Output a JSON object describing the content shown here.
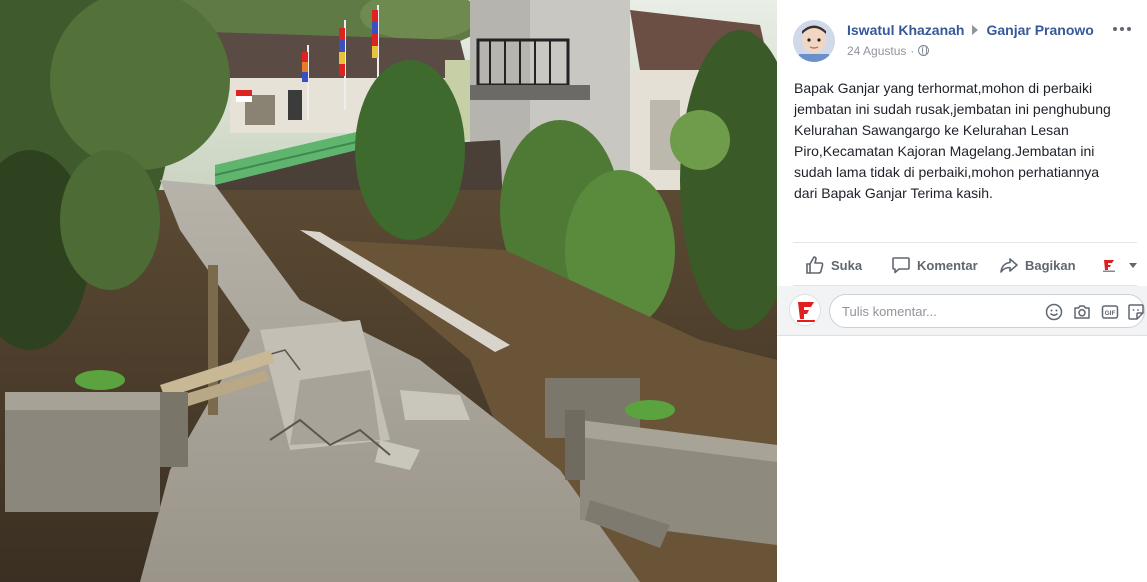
{
  "post": {
    "author": "Iswatul Khazanah",
    "target_page": "Ganjar Pranowo",
    "date": "24 Agustus",
    "separator": "·",
    "text_lines": [
      "Bapak Ganjar yang terhormat,mohon di perbaiki",
      "jembatan ini sudah rusak,jembatan ini penghubung",
      "Kelurahan Sawangargo ke Kelurahan Lesan",
      "Piro,Kecamatan Kajoran Magelang.Jembatan ini",
      "sudah lama tidak di perbaiki,mohon perhatiannya",
      "dari Bapak Ganjar Terima kasih."
    ]
  },
  "actions": {
    "like_label": "Suka",
    "comment_label": "Komentar",
    "share_label": "Bagikan"
  },
  "comment": {
    "placeholder": "Tulis komentar..."
  },
  "icons": {
    "privacy": "globe-icon",
    "like": "thumbs-up-icon",
    "comment": "speech-bubble-icon",
    "share": "share-arrow-icon",
    "emoji": "smiley-icon",
    "camera": "camera-icon",
    "gif": "gif-icon",
    "sticker": "sticker-icon"
  },
  "colors": {
    "link": "#365899",
    "text": "#1d2129",
    "muted": "#90949c",
    "brand_red": "#e02020"
  }
}
